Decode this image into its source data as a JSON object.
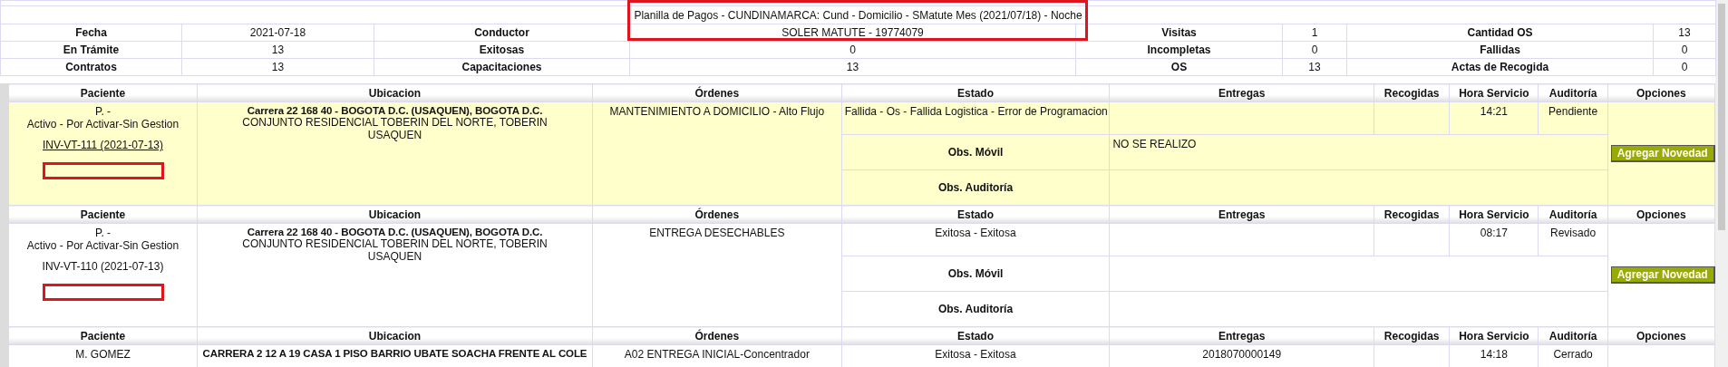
{
  "summary": {
    "title": "Planilla de Pagos - CUNDINAMARCA: Cund - Domicilio - SMatute Mes (2021/07/18) - Noche",
    "rows": [
      [
        {
          "label": "Fecha",
          "value": "2021-07-18"
        },
        {
          "label": "Conductor",
          "value": "SOLER MATUTE - 19774079"
        },
        {
          "label": "Visitas",
          "value": "1"
        },
        {
          "label": "Cantidad OS",
          "value": "13"
        }
      ],
      [
        {
          "label": "En Trámite",
          "value": "13"
        },
        {
          "label": "Exitosas",
          "value": "0"
        },
        {
          "label": "Incompletas",
          "value": "0"
        },
        {
          "label": "Fallidas",
          "value": "0"
        }
      ],
      [
        {
          "label": "Contratos",
          "value": "13"
        },
        {
          "label": "Capacitaciones",
          "value": "13"
        },
        {
          "label": "OS",
          "value": "13"
        },
        {
          "label": "Actas de Recogida",
          "value": "0"
        }
      ]
    ]
  },
  "records": [
    {
      "columns": [
        "Paciente",
        "Ubicacion",
        "Órdenes",
        "Estado",
        "Entregas",
        "Recogidas",
        "Hora Servicio",
        "Auditoría",
        "Opciones"
      ],
      "highlighted": true,
      "patient": "P. -",
      "patient_status": "Activo - Por Activar-Sin Gestion",
      "document": "INV-VT-111 (2021-07-13)",
      "document_linked": true,
      "address": "Carrera 22 168 40 - BOGOTA D.C. (USAQUEN), BOGOTA D.C.",
      "address_detail": "CONJUNTO RESIDENCIAL TOBERIN DEL NORTE, TOBERIN USAQUEN",
      "orders": "MANTENIMIENTO A DOMICILIO - Alto Flujo",
      "status": "Fallida - Os - Fallida Logistica - Error de Programacion",
      "service_time": "14:21",
      "audit": "Pendiente",
      "obs_mobile_label": "Obs. Móvil",
      "obs_mobile": "NO SE REALIZO",
      "obs_audit_label": "Obs. Auditoría",
      "button": "Agregar Novedad"
    },
    {
      "columns": [
        "Paciente",
        "Ubicacion",
        "Órdenes",
        "Estado",
        "Entregas",
        "Recogidas",
        "Hora Servicio",
        "Auditoría",
        "Opciones"
      ],
      "highlighted": false,
      "patient": "P. -",
      "patient_status": "Activo - Por Activar-Sin Gestion",
      "document": "INV-VT-110 (2021-07-13)",
      "document_linked": false,
      "address": "Carrera 22 168 40 - BOGOTA D.C. (USAQUEN), BOGOTA D.C.",
      "address_detail": "CONJUNTO RESIDENCIAL TOBERIN DEL NORTE, TOBERIN USAQUEN",
      "orders": "ENTREGA DESECHABLES",
      "status": "Exitosa - Exitosa",
      "service_time": "08:17",
      "audit": "Revisado",
      "obs_mobile_label": "Obs. Móvil",
      "obs_audit_label": "Obs. Auditoría",
      "button": "Agregar Novedad"
    },
    {
      "columns": [
        "Paciente",
        "Ubicacion",
        "Órdenes",
        "Estado",
        "Entregas",
        "Recogidas",
        "Hora Servicio",
        "Auditoría",
        "Opciones"
      ],
      "highlighted": false,
      "patient": "M. GOMEZ",
      "address": "CARRERA 2 12 A 19 CASA 1 PISO BARRIO UBATE SOACHA FRENTE AL COLE",
      "orders": "A02 ENTREGA INICIAL-Concentrador",
      "status": "Exitosa - Exitosa",
      "deliveries": "2018070000149",
      "service_time": "14:18",
      "audit": "Cerrado"
    }
  ]
}
